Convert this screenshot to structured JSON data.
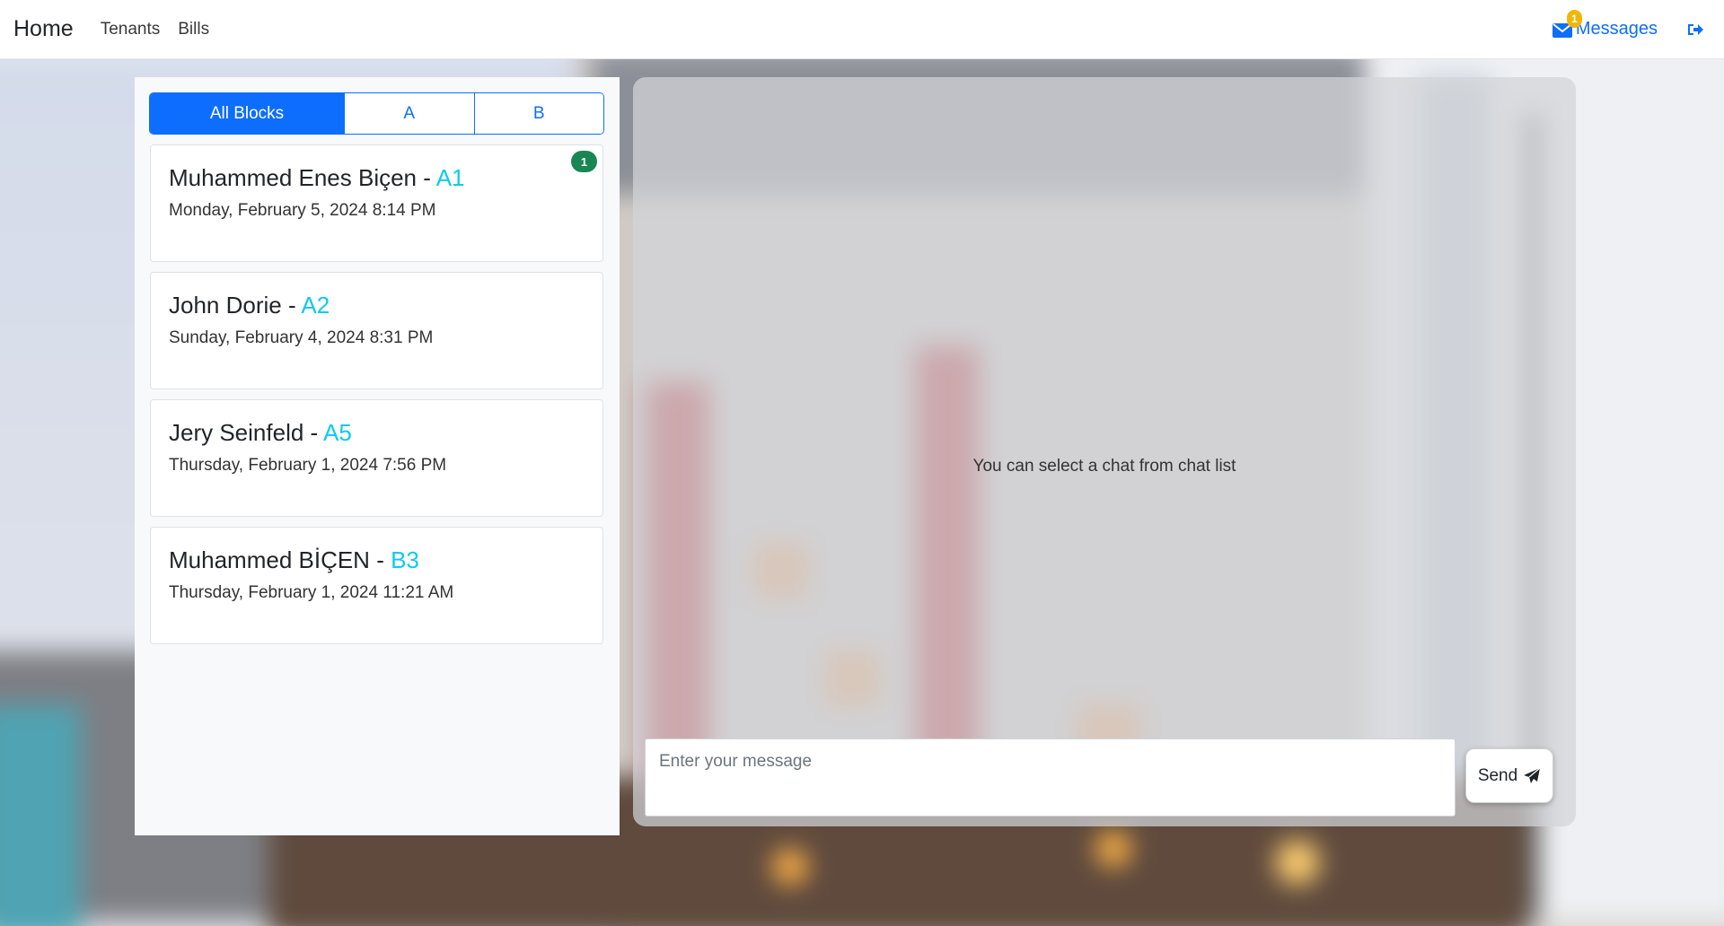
{
  "navbar": {
    "brand": "Home",
    "links": [
      "Tenants",
      "Bills"
    ],
    "messages_label": "Messages",
    "messages_badge": "1",
    "icons": [
      "envelope-icon",
      "logout-icon"
    ]
  },
  "block_tabs": {
    "items": [
      "All Blocks",
      "A",
      "B"
    ],
    "active": "All Blocks"
  },
  "chats": [
    {
      "name": "Muhammed Enes Biçen",
      "separator": " - ",
      "unit": "A1",
      "date": "Monday, February 5, 2024 8:14 PM",
      "unread": "1"
    },
    {
      "name": "John Dorie",
      "separator": " - ",
      "unit": "A2",
      "date": "Sunday, February 4, 2024 8:31 PM",
      "unread": ""
    },
    {
      "name": "Jery Seinfeld",
      "separator": " - ",
      "unit": "A5",
      "date": "Thursday, February 1, 2024 7:56 PM",
      "unread": ""
    },
    {
      "name": "Muhammed BİÇEN",
      "separator": " - ",
      "unit": "B3",
      "date": "Thursday, February 1, 2024 11:21 AM",
      "unread": ""
    }
  ],
  "chat_panel": {
    "empty_text": "You can select a chat from chat list",
    "input_placeholder": "Enter your message",
    "send_label": "Send"
  },
  "colors": {
    "primary": "#0d6efd",
    "unit": "#0dcaf0",
    "unread_badge": "#198754",
    "messages_badge": "#f2b705"
  }
}
